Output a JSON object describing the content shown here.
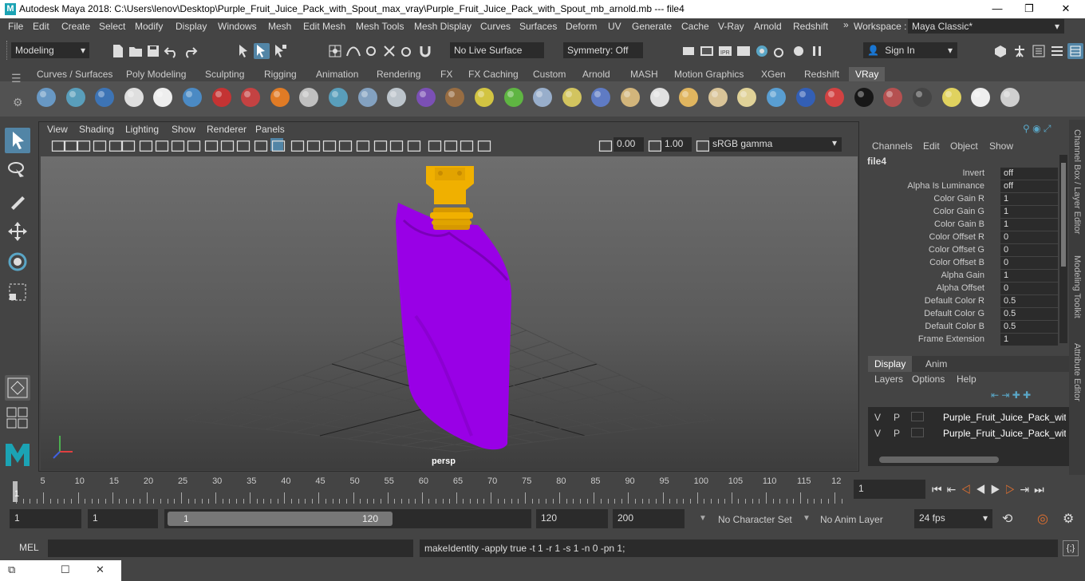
{
  "titlebar": {
    "logo": "M",
    "title": "Autodesk Maya 2018: C:\\Users\\lenov\\Desktop\\Purple_Fruit_Juice_Pack_with_Spout_max_vray\\Purple_Fruit_Juice_Pack_with_Spout_mb_arnold.mb   ---   file4",
    "minimize": "—",
    "maximize": "❐",
    "close": "✕"
  },
  "menubar": {
    "items": [
      "File",
      "Edit",
      "Create",
      "Select",
      "Modify",
      "Display",
      "Windows",
      "Mesh",
      "Edit Mesh",
      "Mesh Tools",
      "Mesh Display",
      "Curves",
      "Surfaces",
      "Deform",
      "UV",
      "Generate",
      "Cache",
      "V-Ray",
      "Arnold",
      "Redshift"
    ],
    "more": "»",
    "workspace_label": "Workspace :",
    "workspace_value": "Maya Classic*"
  },
  "statusline": {
    "mode": "Modeling",
    "live_surface": "No Live Surface",
    "symmetry": "Symmetry: Off",
    "sign_in": "Sign In"
  },
  "shelf": {
    "tabs": [
      "Curves / Surfaces",
      "Poly Modeling",
      "Sculpting",
      "Rigging",
      "Animation",
      "Rendering",
      "FX",
      "FX Caching",
      "Custom",
      "Arnold",
      "MASH",
      "Motion Graphics",
      "XGen",
      "Redshift",
      "VRay"
    ],
    "active_tab": "VRay",
    "icons": [
      "vray-settings-icon",
      "vray-framebuffer-icon",
      "vray-vfb-icon",
      "vray-logo-icon",
      "vray-render-icon",
      "vray-sphere-icon",
      "vray-camera-icon",
      "vray-material-icon",
      "vray-fire-icon",
      "vray-plane-icon",
      "vray-light-icon",
      "vray-cone-icon",
      "vray-mesh-icon",
      "vray-proxy-icon",
      "vray-fur-icon",
      "vray-globe-icon",
      "vray-grass-icon",
      "vray-flake-icon",
      "vray-curve-icon",
      "vray-ball-icon",
      "vray-dome-icon",
      "vray-spot-icon",
      "vray-sun-icon",
      "vray-cone-light-icon",
      "vray-sun2-icon",
      "vray-rect-icon",
      "vray-sphere2-icon",
      "vray-flag-icon",
      "vray-checker-icon",
      "vray-render-elem-icon",
      "vray-table-icon",
      "vray-bulb-icon",
      "vray-cloud-icon",
      "help-icon"
    ]
  },
  "viewport": {
    "menu": [
      "View",
      "Shading",
      "Lighting",
      "Show",
      "Renderer",
      "Panels"
    ],
    "exposure": "0.00",
    "gamma": "1.00",
    "colorspace": "sRGB gamma",
    "camera_label": "persp"
  },
  "channelbox": {
    "menu": [
      "Channels",
      "Edit",
      "Object",
      "Show"
    ],
    "node": "file4",
    "attrs": [
      {
        "label": "Invert",
        "value": "off"
      },
      {
        "label": "Alpha Is Luminance",
        "value": "off"
      },
      {
        "label": "Color Gain R",
        "value": "1"
      },
      {
        "label": "Color Gain G",
        "value": "1"
      },
      {
        "label": "Color Gain B",
        "value": "1"
      },
      {
        "label": "Color Offset R",
        "value": "0"
      },
      {
        "label": "Color Offset G",
        "value": "0"
      },
      {
        "label": "Color Offset B",
        "value": "0"
      },
      {
        "label": "Alpha Gain",
        "value": "1"
      },
      {
        "label": "Alpha Offset",
        "value": "0"
      },
      {
        "label": "Default Color R",
        "value": "0.5"
      },
      {
        "label": "Default Color G",
        "value": "0.5"
      },
      {
        "label": "Default Color B",
        "value": "0.5"
      },
      {
        "label": "Frame Extension",
        "value": "1"
      }
    ]
  },
  "layereditor": {
    "tabs": [
      "Display",
      "Anim"
    ],
    "active_tab": "Display",
    "menu": [
      "Layers",
      "Options",
      "Help"
    ],
    "layers": [
      {
        "v": "V",
        "p": "P",
        "name": "Purple_Fruit_Juice_Pack_with_Spout"
      },
      {
        "v": "V",
        "p": "P",
        "name": "Purple_Fruit_Juice_Pack_with_Spout"
      }
    ]
  },
  "sidetabs": [
    "Channel Box / Layer Editor",
    "Modeling Toolkit",
    "Attribute Editor"
  ],
  "timeslider": {
    "ticks": [
      "5",
      "10",
      "15",
      "20",
      "25",
      "30",
      "35",
      "40",
      "45",
      "50",
      "55",
      "60",
      "65",
      "70",
      "75",
      "80",
      "85",
      "90",
      "95",
      "100",
      "105",
      "110",
      "115",
      "12"
    ],
    "current_frame_marker": "1",
    "current_frame": "1"
  },
  "rangeslider": {
    "start": "1",
    "playback_start": "1",
    "range_start": "1",
    "range_end": "120",
    "playback_end": "120",
    "end": "200",
    "character_set": "No Character Set",
    "anim_layer": "No Anim Layer",
    "fps": "24 fps"
  },
  "cmdline": {
    "lang": "MEL",
    "result": "makeIdentity -apply true -t 1 -r 1 -s 1 -n 0 -pn 1;"
  },
  "colors": {
    "purple": "#9900e6",
    "gold": "#f0b000",
    "accent": "#5285a6"
  }
}
